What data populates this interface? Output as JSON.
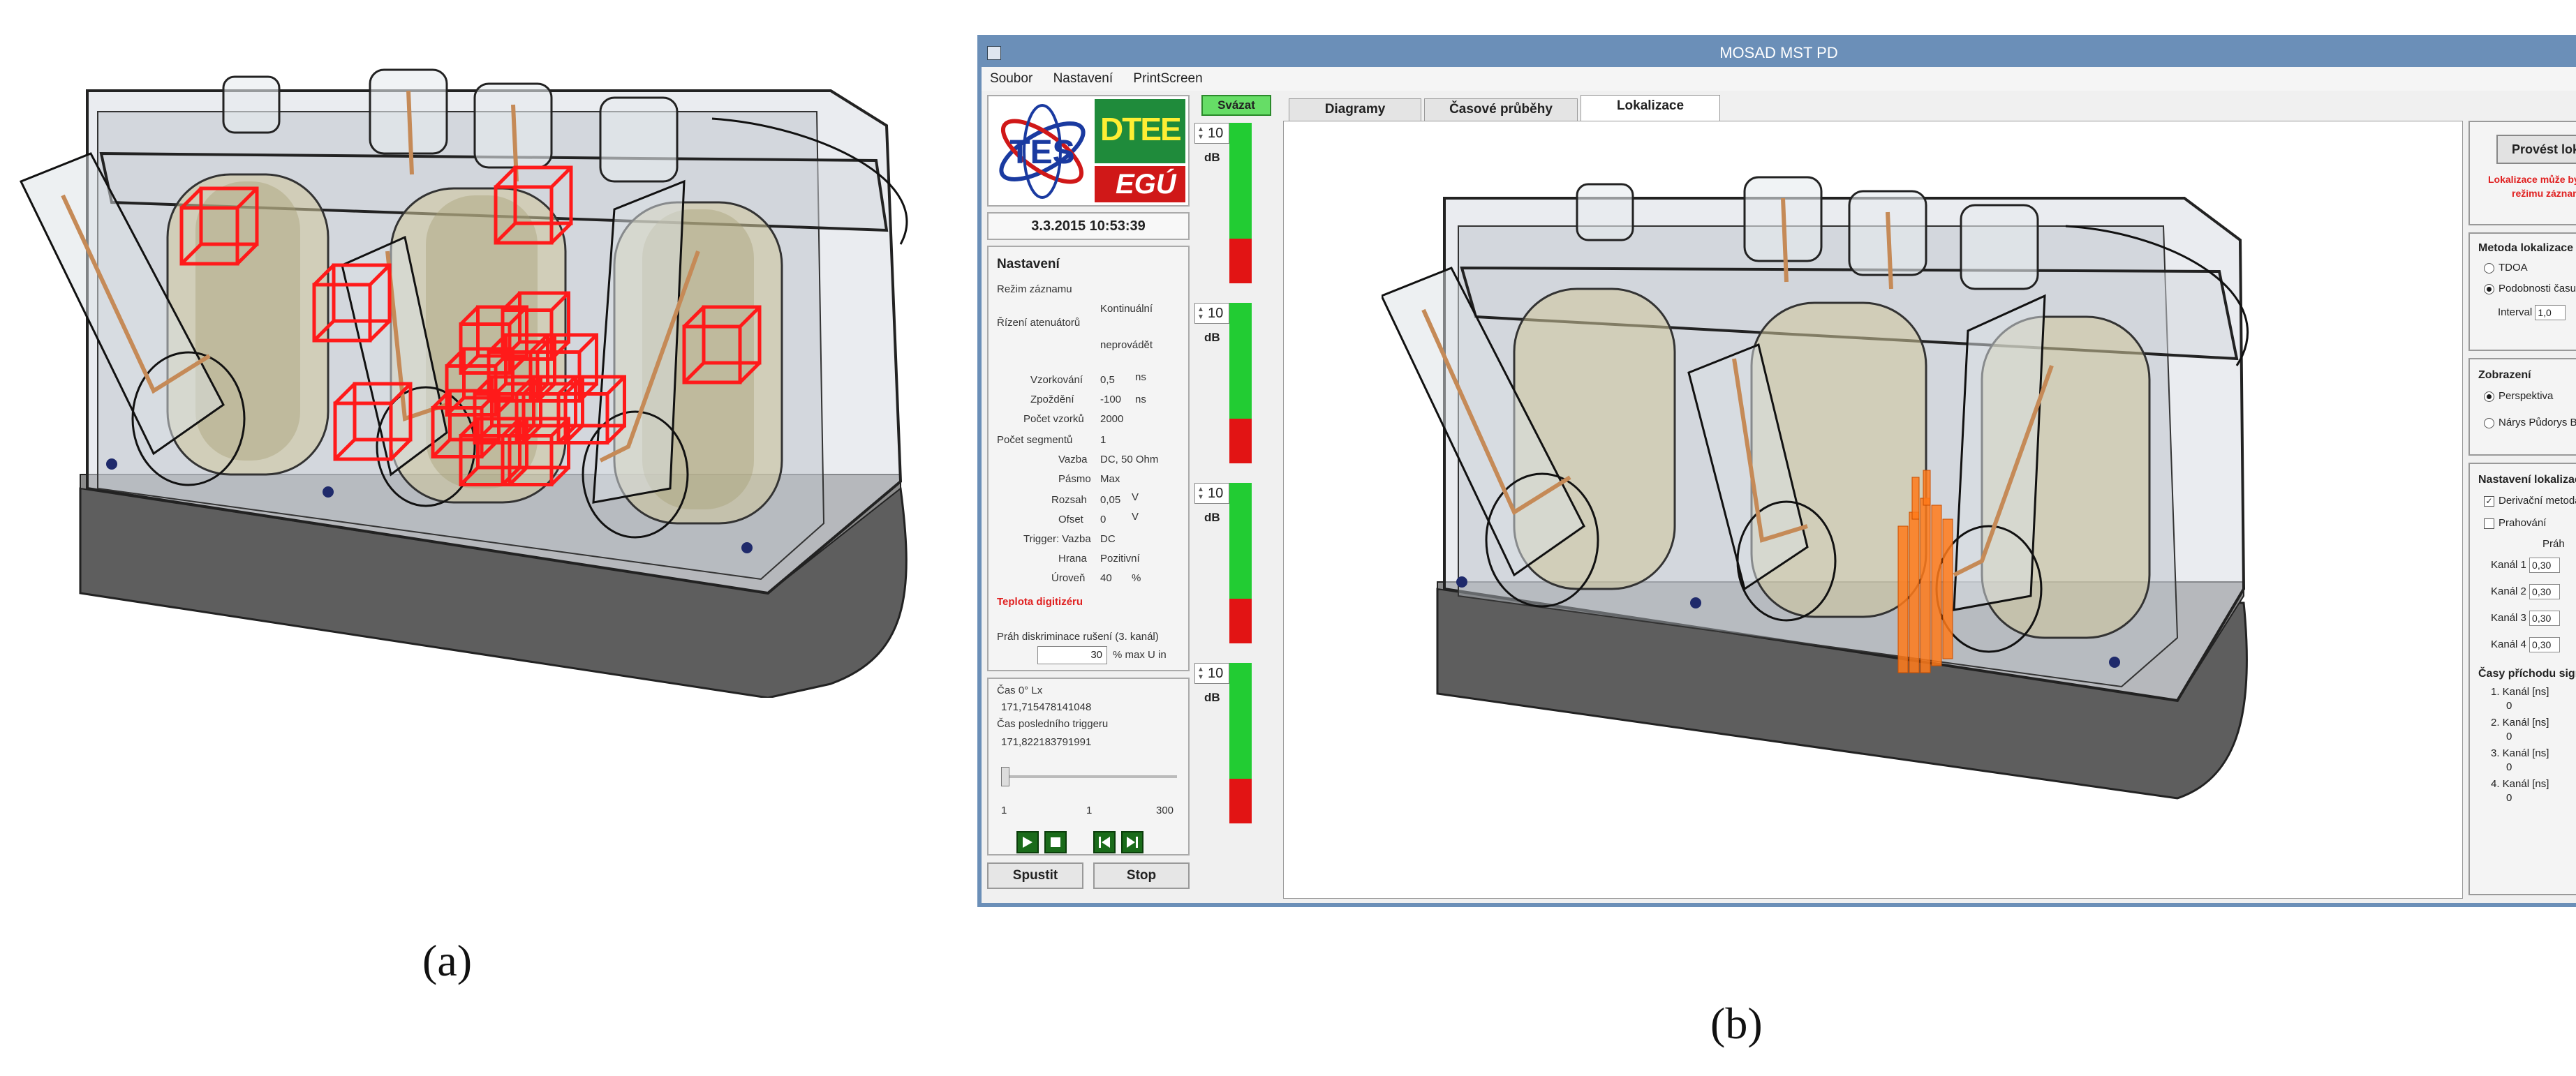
{
  "captions": {
    "a": "(a)",
    "b": "(b)"
  },
  "window": {
    "title": "MOSAD MST PD"
  },
  "menu": [
    "Soubor",
    "Nastavení",
    "PrintScreen"
  ],
  "logos": {
    "tes": "TES",
    "dtee": "DTEE",
    "egu": "EGÚ"
  },
  "datetime": "3.3.2015 10:53:39",
  "settings": {
    "title": "Nastavení",
    "rezim_label": "Režim záznamu",
    "rezim_value": "Kontinuální",
    "atten_label": "Řízení atenuátorů",
    "atten_value": "neprovádět",
    "vzork_label": "Vzorkování",
    "vzork_value": "0,5",
    "vzork_unit": "ns",
    "zpozd_label": "Zpoždění",
    "zpozd_value": "-100",
    "zpozd_unit": "ns",
    "pocvz_label": "Počet vzorků",
    "pocvz_value": "2000",
    "pocseg_label": "Počet segmentů",
    "pocseg_value": "1",
    "vazba_label": "Vazba",
    "vazba_value": "DC, 50 Ohm",
    "pasmo_label": "Pásmo",
    "pasmo_value": "Max",
    "rozsah_label": "Rozsah",
    "rozsah_value": "0,05",
    "rozsah_unit": "V",
    "ofset_label": "Ofset",
    "ofset_value": "0",
    "ofset_unit": "V",
    "trig_label": "Trigger: Vazba",
    "trig_value": "DC",
    "hrana_label": "Hrana",
    "hrana_value": "Pozitivní",
    "uroven_label": "Úroveň",
    "uroven_value": "40",
    "uroven_unit": "%",
    "teplota": "Teplota digitizéru",
    "prah_label": "Práh diskriminace rušení (3. kanál)",
    "prah_value": "30",
    "prah_unit": "% max U in"
  },
  "time": {
    "cas_label": "Čas 0° Lx",
    "cas_value": "171,715478141048",
    "last_label": "Čas posledního triggeru",
    "last_value": "171,822183791991",
    "slider_min": "1",
    "slider_val": "1",
    "slider_max": "300"
  },
  "buttons": {
    "start": "Spustit",
    "stop": "Stop",
    "svazat": "Svázat"
  },
  "meters": [
    {
      "value": "10",
      "unit": "dB",
      "level": 0.72
    },
    {
      "value": "10",
      "unit": "dB",
      "level": 0.72
    },
    {
      "value": "10",
      "unit": "dB",
      "level": 0.72
    },
    {
      "value": "10",
      "unit": "dB",
      "level": 0.72
    }
  ],
  "tabs": [
    "Diagramy",
    "Časové průběhy",
    "Lokalizace"
  ],
  "active_tab": "Lokalizace",
  "right": {
    "run_button": "Provést lokali",
    "warn1": "Lokalizace může být zp",
    "warn2": "režimu záznamu da",
    "method_title": "Metoda lokalizace",
    "method_tdoa": "TDOA",
    "method_similar": "Podobnosti času příc",
    "interval_label": "Interval",
    "interval_value": "1,0",
    "display_title": "Zobrazení",
    "display_persp": "Perspektiva",
    "display_views": "Nárys Půdorys Boko",
    "loc_title": "Nastavení lokalizace",
    "deriv": "Derivační metoda",
    "prahovani": "Prahování",
    "prah_col": "Práh",
    "channels": [
      {
        "label": "Kanál 1",
        "value": "0,30"
      },
      {
        "label": "Kanál 2",
        "value": "0,30"
      },
      {
        "label": "Kanál 3",
        "value": "0,30"
      },
      {
        "label": "Kanál 4",
        "value": "0,30"
      }
    ],
    "arrival_title": "Časy příchodu signálu",
    "arrivals": [
      {
        "label": "1. Kanál [ns]",
        "value": "0"
      },
      {
        "label": "2. Kanál [ns]",
        "value": "0"
      },
      {
        "label": "3. Kanál [ns]",
        "value": "0"
      },
      {
        "label": "4. Kanál [ns]",
        "value": "0"
      }
    ]
  },
  "colors": {
    "window_frame": "#6b8fb8",
    "locator_boxes": "#ff1a1a",
    "locator_cloud": "#ff7a1a",
    "meter_green": "#22cc33",
    "meter_red": "#e21414"
  }
}
